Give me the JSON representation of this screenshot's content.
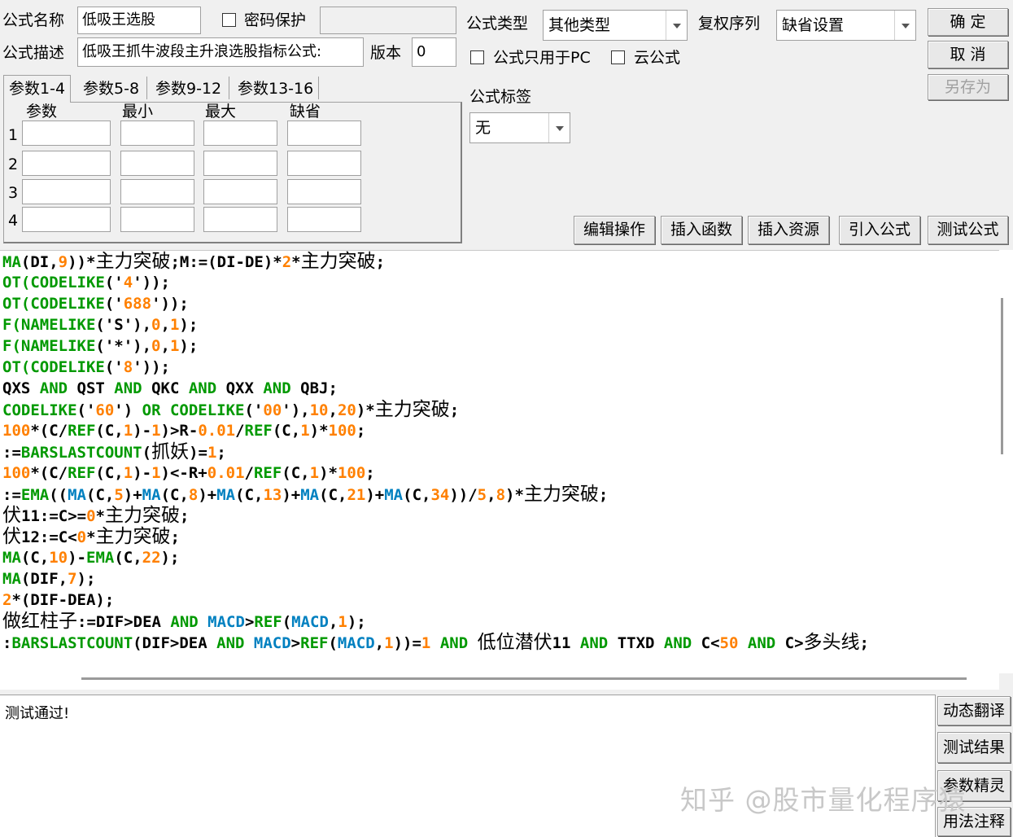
{
  "form": {
    "name_label": "公式名称",
    "name_value": "低吸王选股",
    "password_label": "密码保护",
    "password_value": "",
    "desc_label": "公式描述",
    "desc_value": "低吸王抓牛波段主升浪选股指标公式:",
    "version_label": "版本",
    "version_value": "0",
    "type_label": "公式类型",
    "type_value": "其他类型",
    "fq_label": "复权序列",
    "fq_value": "缺省设置",
    "pc_only_label": "公式只用于PC",
    "cloud_label": "云公式",
    "tag_label": "公式标签",
    "tag_value": "无"
  },
  "buttons": {
    "ok": "确 定",
    "cancel": "取 消",
    "save_as": "另存为",
    "edit_ops": "编辑操作",
    "insert_func": "插入函数",
    "insert_res": "插入资源",
    "import_formula": "引入公式",
    "test_formula": "测试公式"
  },
  "tabs": [
    "参数1-4",
    "参数5-8",
    "参数9-12",
    "参数13-16"
  ],
  "params": {
    "headers": [
      "参数",
      "最小",
      "最大",
      "缺省"
    ],
    "rows": [
      "1",
      "2",
      "3",
      "4"
    ]
  },
  "code_lines": [
    [
      [
        "MA",
        "g"
      ],
      [
        "(DI,",
        "b"
      ],
      [
        "9",
        "o"
      ],
      [
        "))*",
        "b"
      ],
      [
        "主力突破",
        "cn"
      ],
      [
        ";M:=(DI-DE)*",
        "b"
      ],
      [
        "2",
        "o"
      ],
      [
        "*",
        "b"
      ],
      [
        "主力突破",
        "cn"
      ],
      [
        ";",
        "b"
      ]
    ],
    [
      [
        "OT(",
        "g"
      ],
      [
        "CODELIKE",
        "g"
      ],
      [
        "('",
        "b"
      ],
      [
        "4",
        "o"
      ],
      [
        "'));",
        "b"
      ]
    ],
    [
      [
        "OT(",
        "g"
      ],
      [
        "CODELIKE",
        "g"
      ],
      [
        "('",
        "b"
      ],
      [
        "688",
        "o"
      ],
      [
        "'));",
        "b"
      ]
    ],
    [
      [
        "F(",
        "g"
      ],
      [
        "NAMELIKE",
        "g"
      ],
      [
        "('S'),",
        "b"
      ],
      [
        "0",
        "o"
      ],
      [
        ",",
        "b"
      ],
      [
        "1",
        "o"
      ],
      [
        ");",
        "b"
      ]
    ],
    [
      [
        "F(",
        "g"
      ],
      [
        "NAMELIKE",
        "g"
      ],
      [
        "('*'),",
        "b"
      ],
      [
        "0",
        "o"
      ],
      [
        ",",
        "b"
      ],
      [
        "1",
        "o"
      ],
      [
        ");",
        "b"
      ]
    ],
    [
      [
        "OT(",
        "g"
      ],
      [
        "CODELIKE",
        "g"
      ],
      [
        "('",
        "b"
      ],
      [
        "8",
        "o"
      ],
      [
        "'));",
        "b"
      ]
    ],
    [
      [
        "QXS ",
        "b"
      ],
      [
        "AND",
        "g"
      ],
      [
        " QST ",
        "b"
      ],
      [
        "AND",
        "g"
      ],
      [
        " QKC ",
        "b"
      ],
      [
        "AND",
        "g"
      ],
      [
        " QXX ",
        "b"
      ],
      [
        "AND",
        "g"
      ],
      [
        " QBJ;",
        "b"
      ]
    ],
    [
      [
        "CODELIKE",
        "g"
      ],
      [
        "('",
        "b"
      ],
      [
        "60",
        "o"
      ],
      [
        "') ",
        "b"
      ],
      [
        "OR",
        "g"
      ],
      [
        " ",
        "b"
      ],
      [
        "CODELIKE",
        "g"
      ],
      [
        "('",
        "b"
      ],
      [
        "00",
        "o"
      ],
      [
        "'),",
        "b"
      ],
      [
        "10",
        "o"
      ],
      [
        ",",
        "b"
      ],
      [
        "20",
        "o"
      ],
      [
        ")*",
        "b"
      ],
      [
        "主力突破",
        "cn"
      ],
      [
        ";",
        "b"
      ]
    ],
    [
      [
        "100",
        "o"
      ],
      [
        "*(C/",
        "b"
      ],
      [
        "REF",
        "g"
      ],
      [
        "(C,",
        "b"
      ],
      [
        "1",
        "o"
      ],
      [
        ")-",
        "b"
      ],
      [
        "1",
        "o"
      ],
      [
        ")>R-",
        "b"
      ],
      [
        "0.01",
        "o"
      ],
      [
        "/",
        "b"
      ],
      [
        "REF",
        "g"
      ],
      [
        "(C,",
        "b"
      ],
      [
        "1",
        "o"
      ],
      [
        ")*",
        "b"
      ],
      [
        "100",
        "o"
      ],
      [
        ";",
        "b"
      ]
    ],
    [
      [
        ":=",
        "b"
      ],
      [
        "BARSLASTCOUNT",
        "g"
      ],
      [
        "(",
        "b"
      ],
      [
        "抓妖",
        "cn"
      ],
      [
        ")=",
        "b"
      ],
      [
        "1",
        "o"
      ],
      [
        ";",
        "b"
      ]
    ],
    [
      [
        "100",
        "o"
      ],
      [
        "*(C/",
        "b"
      ],
      [
        "REF",
        "g"
      ],
      [
        "(C,",
        "b"
      ],
      [
        "1",
        "o"
      ],
      [
        ")-",
        "b"
      ],
      [
        "1",
        "o"
      ],
      [
        ")<-R+",
        "b"
      ],
      [
        "0.01",
        "o"
      ],
      [
        "/",
        "b"
      ],
      [
        "REF",
        "g"
      ],
      [
        "(C,",
        "b"
      ],
      [
        "1",
        "o"
      ],
      [
        ")*",
        "b"
      ],
      [
        "100",
        "o"
      ],
      [
        ";",
        "b"
      ]
    ],
    [
      [
        ":=",
        "b"
      ],
      [
        "EMA",
        "g"
      ],
      [
        "((",
        "b"
      ],
      [
        "MA",
        "bl"
      ],
      [
        "(C,",
        "b"
      ],
      [
        "5",
        "o"
      ],
      [
        ")+",
        "b"
      ],
      [
        "MA",
        "bl"
      ],
      [
        "(C,",
        "b"
      ],
      [
        "8",
        "o"
      ],
      [
        ")+",
        "b"
      ],
      [
        "MA",
        "bl"
      ],
      [
        "(C,",
        "b"
      ],
      [
        "13",
        "o"
      ],
      [
        ")+",
        "b"
      ],
      [
        "MA",
        "bl"
      ],
      [
        "(C,",
        "b"
      ],
      [
        "21",
        "o"
      ],
      [
        ")+",
        "b"
      ],
      [
        "MA",
        "bl"
      ],
      [
        "(C,",
        "b"
      ],
      [
        "34",
        "o"
      ],
      [
        "))/",
        "b"
      ],
      [
        "5",
        "o"
      ],
      [
        ",",
        "b"
      ],
      [
        "8",
        "o"
      ],
      [
        ")*",
        "b"
      ],
      [
        "主力突破",
        "cn"
      ],
      [
        ";",
        "b"
      ]
    ],
    [
      [
        "伏",
        "cn"
      ],
      [
        "11:=C>=",
        "b"
      ],
      [
        "0",
        "o"
      ],
      [
        "*",
        "b"
      ],
      [
        "主力突破",
        "cn"
      ],
      [
        ";",
        "b"
      ]
    ],
    [
      [
        "伏",
        "cn"
      ],
      [
        "12:=C<",
        "b"
      ],
      [
        "0",
        "o"
      ],
      [
        "*",
        "b"
      ],
      [
        "主力突破",
        "cn"
      ],
      [
        ";",
        "b"
      ]
    ],
    [
      [
        "MA",
        "g"
      ],
      [
        "(C,",
        "b"
      ],
      [
        "10",
        "o"
      ],
      [
        ")-",
        "b"
      ],
      [
        "EMA",
        "g"
      ],
      [
        "(C,",
        "b"
      ],
      [
        "22",
        "o"
      ],
      [
        ");",
        "b"
      ]
    ],
    [
      [
        "MA",
        "g"
      ],
      [
        "(DIF,",
        "b"
      ],
      [
        "7",
        "o"
      ],
      [
        ");",
        "b"
      ]
    ],
    [
      [
        "2",
        "o"
      ],
      [
        "*(DIF-DEA);",
        "b"
      ]
    ],
    [
      [
        "做红柱子",
        "cn"
      ],
      [
        ":=DIF>DEA ",
        "b"
      ],
      [
        "AND",
        "g"
      ],
      [
        " ",
        "b"
      ],
      [
        "MACD",
        "bl"
      ],
      [
        ">",
        "b"
      ],
      [
        "REF",
        "g"
      ],
      [
        "(",
        "b"
      ],
      [
        "MACD",
        "bl"
      ],
      [
        ",",
        "b"
      ],
      [
        "1",
        "o"
      ],
      [
        ");",
        "b"
      ]
    ],
    [
      [
        ":",
        "b"
      ],
      [
        "BARSLASTCOUNT",
        "g"
      ],
      [
        "(DIF>DEA ",
        "b"
      ],
      [
        "AND",
        "g"
      ],
      [
        " ",
        "b"
      ],
      [
        "MACD",
        "bl"
      ],
      [
        ">",
        "b"
      ],
      [
        "REF",
        "g"
      ],
      [
        "(",
        "b"
      ],
      [
        "MACD",
        "bl"
      ],
      [
        ",",
        "b"
      ],
      [
        "1",
        "o"
      ],
      [
        "))=",
        "b"
      ],
      [
        "1",
        "o"
      ],
      [
        " ",
        "b"
      ],
      [
        "AND",
        "g"
      ],
      [
        " ",
        "b"
      ],
      [
        "低位潜伏",
        "cn"
      ],
      [
        "11 ",
        "b"
      ],
      [
        "AND",
        "g"
      ],
      [
        " TTXD ",
        "b"
      ],
      [
        "AND",
        "g"
      ],
      [
        " C<",
        "b"
      ],
      [
        "50",
        "o"
      ],
      [
        " ",
        "b"
      ],
      [
        "AND",
        "g"
      ],
      [
        " C>",
        "b"
      ],
      [
        "多头线",
        "cn"
      ],
      [
        ";",
        "b"
      ]
    ]
  ],
  "output": {
    "text": "测试通过!"
  },
  "side_buttons": [
    "动态翻译",
    "测试结果",
    "参数精灵",
    "用法注释"
  ],
  "watermark": "知乎 @股市量化程序猿"
}
